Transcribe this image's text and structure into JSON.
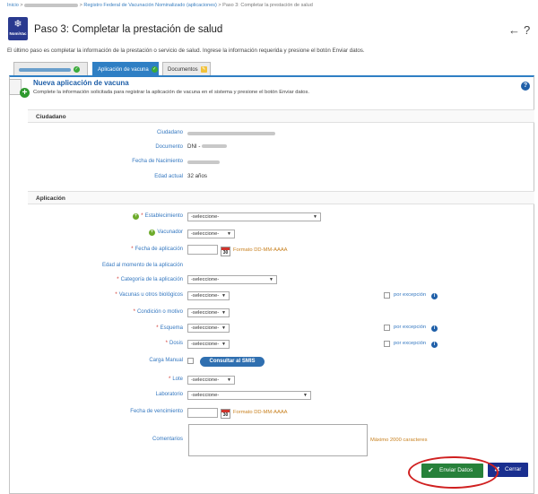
{
  "breadcrumb": {
    "home": "Inicio",
    "sep": ">",
    "section": "Registro Federal de Vacunación Nominalizado (aplicaciones)",
    "current": "Paso 3: Completar la prestación de salud"
  },
  "logo": {
    "text": "NomiVac",
    "icon": "snowflake-logo"
  },
  "page": {
    "title": "Paso 3: Completar la prestación de salud",
    "intro": "El último paso es completar la información de la prestación o servicio de salud. Ingrese la información requerida y presione el botón Enviar datos."
  },
  "top_icons": {
    "back": "←",
    "help": "?"
  },
  "tabs": [
    {
      "label": ""
    },
    {
      "label": "Aplicación de vacuna"
    },
    {
      "label": "Documentos"
    }
  ],
  "panel": {
    "title": "Nueva aplicación de vacuna",
    "desc": "Complete la información solicitada para registrar la aplicación de vacuna en el sistema y presione el botón Enviar datos.",
    "help": "?"
  },
  "ciudadano": {
    "section": "Ciudadano",
    "ciudadano_label": "Ciudadano",
    "documento_label": "Documento",
    "documento_value": "DNI -",
    "nacimiento_label": "Fecha de Nacimiento",
    "edad_label": "Edad actual",
    "edad_value": "32 años"
  },
  "aplicacion": {
    "section": "Aplicación",
    "establecimiento": "Establecimiento",
    "vacunador": "Vacunador",
    "fecha_aplicacion": "Fecha de aplicación",
    "edad_momento": "Edad al momento de la aplicación",
    "categoria": "Categoría de la aplicación",
    "vacunas": "Vacunas u otros biológicos",
    "condicion": "Condición o motivo",
    "esquema": "Esquema",
    "dosis": "Dosis",
    "carga_manual": "Carga Manual",
    "consultar": "Consultar al SMIS",
    "lote": "Lote",
    "laboratorio": "Laboratorio",
    "fecha_vencimiento": "Fecha de vencimiento",
    "comentarios": "Comentarios",
    "select_placeholder": "-seleccione-",
    "format": "Formato DD-MM-AAAA",
    "por_excepcion": "por excepción",
    "max_chars": "Máximo 2000 caracteres",
    "required_mark": "*",
    "cal_day": "30"
  },
  "buttons": {
    "send": "Enviar Datos",
    "close": "Cerrar"
  }
}
